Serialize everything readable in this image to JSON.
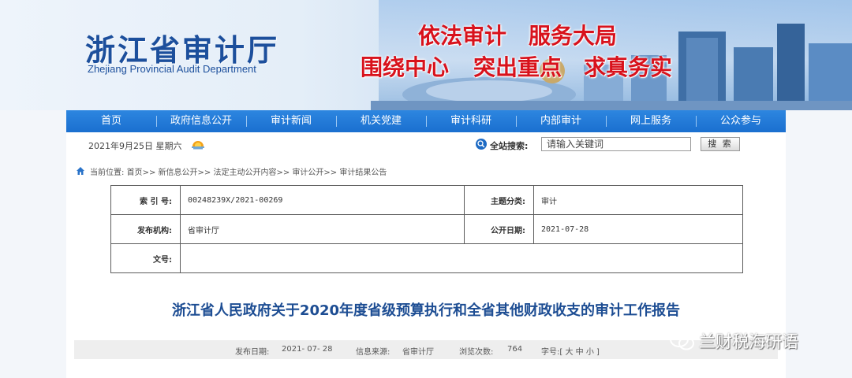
{
  "header": {
    "title_cn": "浙江省审计厅",
    "title_en": "Zhejiang Provincial Audit Department",
    "slogans": [
      "依法审计",
      "服务大局",
      "围绕中心",
      "突出重点",
      "求真务实"
    ]
  },
  "nav": {
    "items": [
      "首页",
      "政府信息公开",
      "审计新闻",
      "机关党建",
      "审计科研",
      "内部审计",
      "网上服务",
      "公众参与"
    ]
  },
  "infobar": {
    "date": "2021年9月25日  星期六",
    "search_label": "全站搜索:",
    "search_placeholder": "请输入关键词",
    "search_button": "搜 索"
  },
  "breadcrumb": {
    "prefix": "当前位置:",
    "items": [
      "首页",
      "新信息公开",
      "法定主动公开内容",
      "审计公开",
      "审计结果公告"
    ],
    "separator": ">>"
  },
  "meta": {
    "index_label": "索 引 号:",
    "index_value": "00248239X/2021-00269",
    "category_label": "主题分类:",
    "category_value": "审计",
    "publisher_label": "发布机构:",
    "publisher_value": "省审计厅",
    "pubdate_label": "公开日期:",
    "pubdate_value": "2021-07-28",
    "docno_label": "文号:",
    "docno_value": ""
  },
  "article": {
    "title": "浙江省人民政府关于2020年度省级预算执行和全省其他财政收支的审计工作报告",
    "date_label": "发布日期:",
    "date_value": "2021- 07- 28",
    "source_label": "信息来源:",
    "source_value": "省审计厅",
    "views_label": "浏览次数:",
    "views_value": "764",
    "fontsize_label": "字号:[",
    "fontsize_large": "大",
    "fontsize_medium": "中",
    "fontsize_small": "小",
    "fontsize_close": "]"
  },
  "watermark": {
    "text": "兰财税海研语"
  },
  "colors": {
    "nav_blue": "#1a6fcf",
    "title_blue": "#1d4d93",
    "slogan_red": "#d8121c"
  }
}
